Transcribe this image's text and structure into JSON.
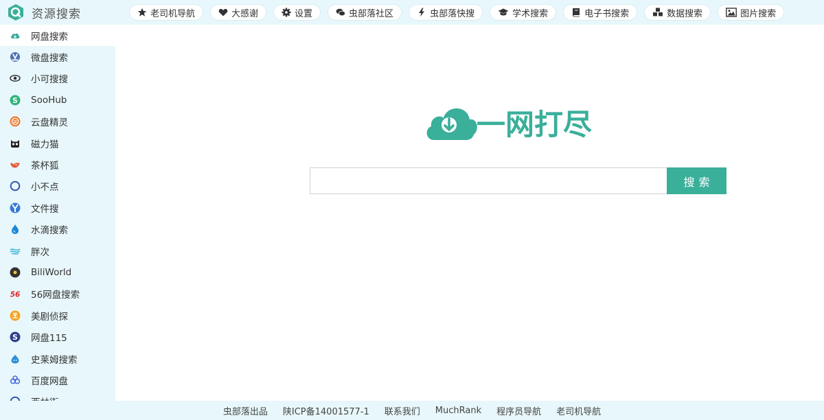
{
  "brand": {
    "title": "资源搜索"
  },
  "topnav": [
    {
      "label": "老司机导航",
      "icon": "star-icon"
    },
    {
      "label": "大感谢",
      "icon": "heart-icon"
    },
    {
      "label": "设置",
      "icon": "gear-icon"
    },
    {
      "label": "虫部落社区",
      "icon": "chat-icon"
    },
    {
      "label": "虫部落快搜",
      "icon": "bolt-icon"
    },
    {
      "label": "学术搜索",
      "icon": "graduation-cap-icon"
    },
    {
      "label": "电子书搜索",
      "icon": "book-icon"
    },
    {
      "label": "数据搜索",
      "icon": "cubes-icon"
    },
    {
      "label": "图片搜索",
      "icon": "image-icon"
    }
  ],
  "sidebar": {
    "items": [
      {
        "label": "网盘搜索",
        "icon": "cloud-download-icon",
        "active": true
      },
      {
        "label": "微盘搜索",
        "icon": "v-badge-icon"
      },
      {
        "label": "小可搜搜",
        "icon": "eye-icon"
      },
      {
        "label": "SooHub",
        "icon": "s-circle-icon"
      },
      {
        "label": "云盘精灵",
        "icon": "cloud-circle-icon"
      },
      {
        "label": "磁力猫",
        "icon": "cat-icon"
      },
      {
        "label": "茶杯狐",
        "icon": "fox-icon"
      },
      {
        "label": "小不点",
        "icon": "ring-icon"
      },
      {
        "label": "文件搜",
        "icon": "globe-icon"
      },
      {
        "label": "水滴搜索",
        "icon": "drop-icon"
      },
      {
        "label": "胖次",
        "icon": "wave-icon"
      },
      {
        "label": "BiliWorld",
        "icon": "dark-circle-icon"
      },
      {
        "label": "56网盘搜索",
        "icon": "56-logo-icon"
      },
      {
        "label": "美剧侦探",
        "icon": "mei-badge-icon"
      },
      {
        "label": "网盘115",
        "icon": "s-dark-icon"
      },
      {
        "label": "史莱姆搜索",
        "icon": "slime-icon"
      },
      {
        "label": "百度网盘",
        "icon": "baidu-cloud-icon"
      },
      {
        "label": "西林街",
        "icon": "partial-ring-icon"
      }
    ]
  },
  "main": {
    "logo_text": "一网打尽",
    "search_placeholder": "",
    "search_button": "搜索"
  },
  "footer": {
    "links": [
      "虫部落出品",
      "陕ICP备14001577-1",
      "联系我们",
      "MuchRank",
      "程序员导航",
      "老司机导航"
    ]
  },
  "colors": {
    "accent": "#3aaf9a",
    "sidebar_bg": "#e8f7fb"
  }
}
